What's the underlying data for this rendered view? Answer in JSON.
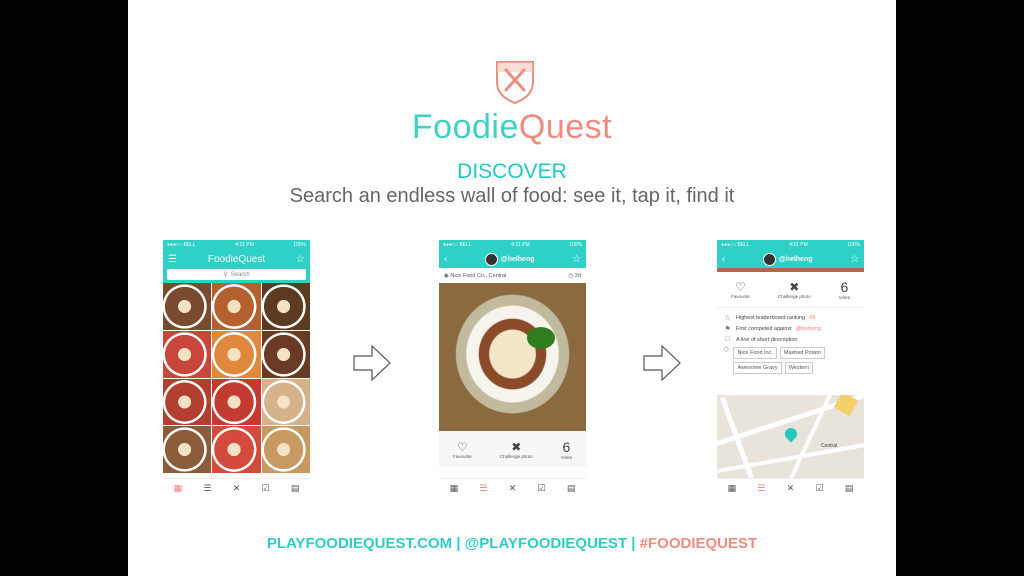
{
  "brand": {
    "part1": "Foodie",
    "part2": "Quest"
  },
  "heading": "DISCOVER",
  "subtitle": "Search an endless wall of food: see it, tap it, find it",
  "footer": {
    "site": "PLAYFOODIEQUEST.COM",
    "separator": "|",
    "handle": "@PLAYFOODIEQUEST",
    "hashtag": "#FOODIEQUEST"
  },
  "status": {
    "carrier": "●●●○○ BELL",
    "time": "4:21 PM",
    "battery": "100%"
  },
  "phone1": {
    "title": "FoodieQuest",
    "search_placeholder": "Search",
    "tiles": [
      "#7a4a2e",
      "#b5612f",
      "#5c3b22",
      "#c9463a",
      "#e0883e",
      "#6a3b24",
      "#b2402f",
      "#c23a30",
      "#d6b28a",
      "#8a5c3a",
      "#d44a3c",
      "#c79a62"
    ]
  },
  "phone2": {
    "username": "@helheng",
    "location": "Nice Food Co., Central",
    "age": "2d",
    "stats": {
      "favourite": "Favourite",
      "challenge": "Challenge photo",
      "votes_count": "6",
      "votes": "Votes"
    }
  },
  "phone3": {
    "username": "@helheng",
    "stats": {
      "favourite": "Favourite",
      "challenge": "Challenge photo",
      "votes_count": "6",
      "votes": "Votes"
    },
    "ranking_label": "Highest leaderboard ranking",
    "ranking_value": "#3",
    "competed_label": "First competed against",
    "competed_value": "@helheng",
    "description": "A line of short description",
    "tags": [
      "Nice Food Inc.",
      "Mashed Potato",
      "Awesome Gravy",
      "Western"
    ],
    "map_label": "Central"
  },
  "colors": {
    "accent": "#2fd0c6",
    "coral": "#f08b80"
  }
}
